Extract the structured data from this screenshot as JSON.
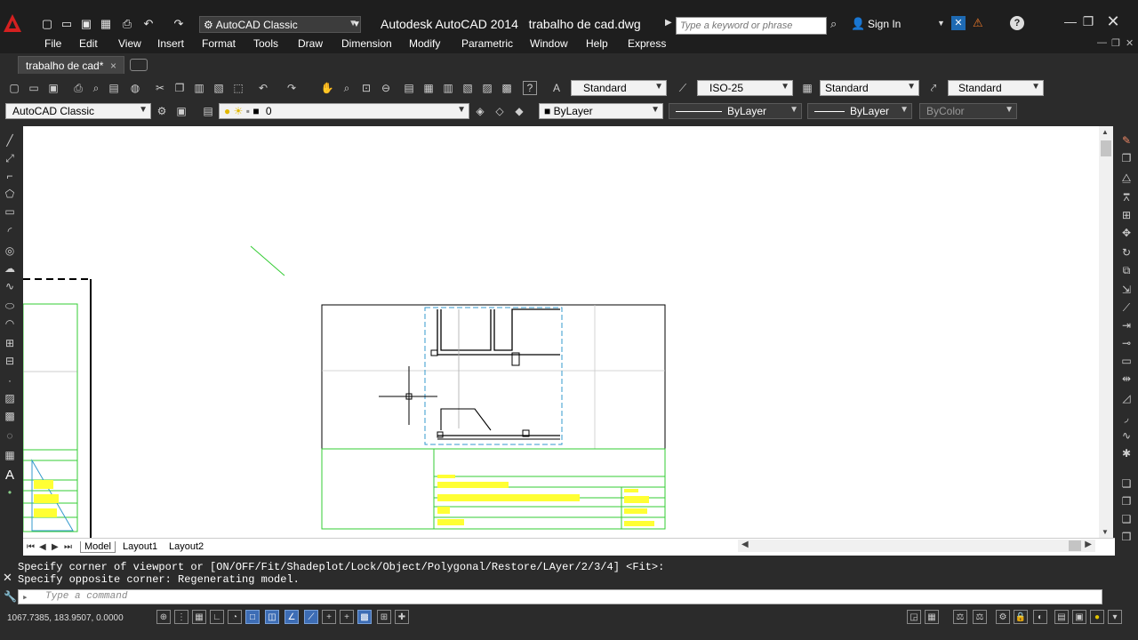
{
  "titlebar": {
    "workspace": "AutoCAD Classic",
    "app_name": "Autodesk AutoCAD 2014",
    "file_name": "trabalho de cad.dwg",
    "search_placeholder": "Type a keyword or phrase",
    "signin": "Sign In"
  },
  "menu": [
    "File",
    "Edit",
    "View",
    "Insert",
    "Format",
    "Tools",
    "Draw",
    "Dimension",
    "Modify",
    "Parametric",
    "Window",
    "Help",
    "Express"
  ],
  "file_tab": {
    "label": "trabalho de cad*",
    "close": "×"
  },
  "styles_toolbar": {
    "text_style": "Standard",
    "dim_style": "ISO-25",
    "table_style": "Standard",
    "mleader_style": "Standard"
  },
  "layers_toolbar": {
    "workspace": "AutoCAD Classic",
    "layer": "0",
    "color": "ByLayer",
    "linetype": "ByLayer",
    "lineweight": "ByLayer",
    "plotstyle": "ByColor"
  },
  "layout_tabs": [
    "Model",
    "Layout1",
    "Layout2"
  ],
  "command": {
    "history": [
      "Specify corner of viewport or [ON/OFF/Fit/Shadeplot/Lock/Object/Polygonal/Restore/LAyer/2/3/4] <Fit>:",
      "Specify opposite corner: Regenerating model."
    ],
    "placeholder": "Type a command"
  },
  "status": {
    "coordinates": "1067.7385, 183.9507, 0.0000"
  },
  "colors": {
    "titlebar": "#1e1e1e",
    "toolbar": "#2b2b2b",
    "canvas": "#ffffff",
    "title_block": "#33cc33",
    "text_yellow": "#ffff00",
    "viewport_dash": "#3399cc"
  }
}
